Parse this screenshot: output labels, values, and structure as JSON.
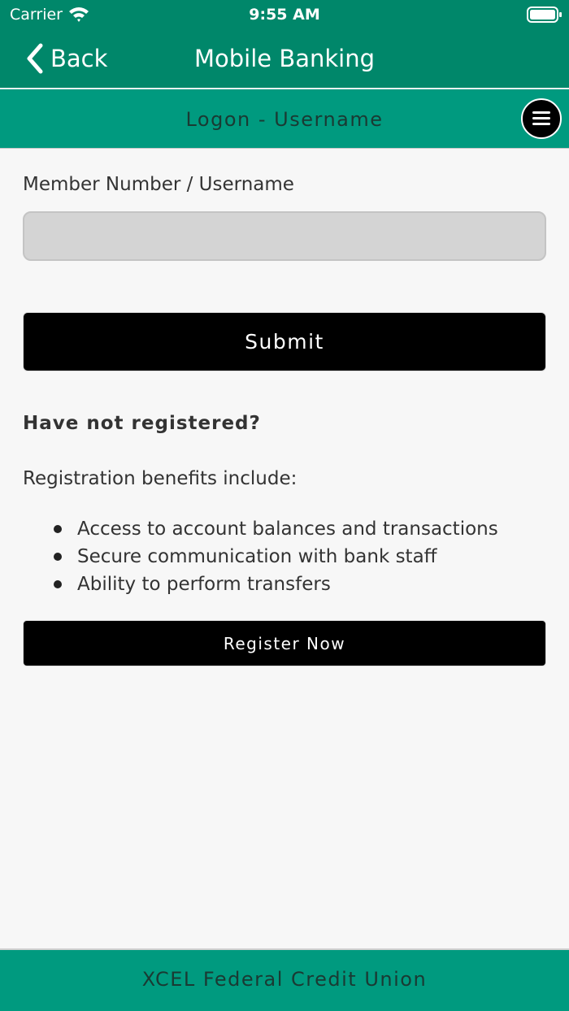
{
  "status_bar": {
    "carrier": "Carrier",
    "time": "9:55 AM",
    "icons": [
      "wifi-icon",
      "battery-icon"
    ]
  },
  "nav": {
    "back_label": "Back",
    "title": "Mobile Banking"
  },
  "subheader": {
    "title": "Logon - Username",
    "menu_icon": "hamburger-menu-icon"
  },
  "form": {
    "username_label": "Member Number / Username",
    "username_value": "",
    "username_placeholder": "",
    "submit_label": "Submit"
  },
  "registration": {
    "heading": "Have not registered?",
    "intro": "Registration benefits include:",
    "benefits": [
      "Access to account balances and transactions",
      "Secure communication with bank staff",
      "Ability to perform transfers"
    ],
    "register_label": "Register Now"
  },
  "footer": {
    "text": "XCEL Federal Credit Union"
  },
  "colors": {
    "nav_bar": "#00876a",
    "subheader": "#009a7f",
    "footer": "#009a7f",
    "button": "#000000",
    "input": "#d4d4d4",
    "background": "#f7f7f7"
  }
}
